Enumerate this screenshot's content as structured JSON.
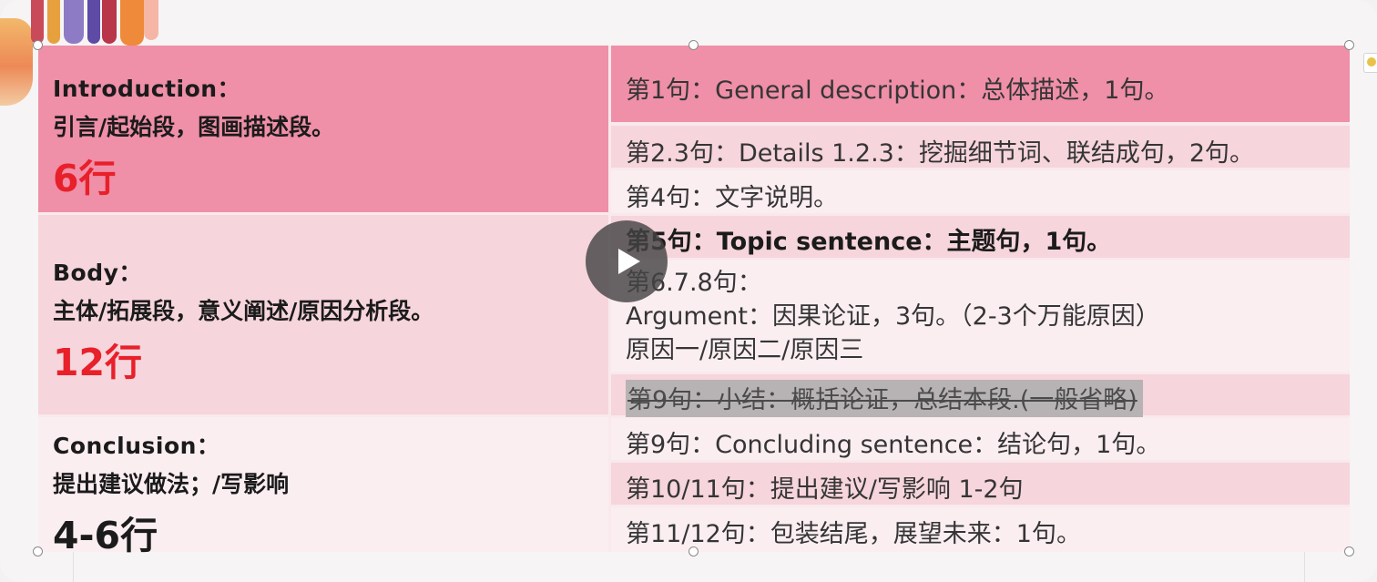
{
  "slide": {
    "sections": [
      {
        "title": "Introduction：",
        "description": "引言/起始段，图画描述段。",
        "lines": "6行",
        "lines_color": "#e8202a",
        "background": "#ef8fa8"
      },
      {
        "title": "Body：",
        "description": "主体/拓展段，意义阐述/原因分析段。",
        "lines": "12行",
        "lines_color": "#e8202a",
        "background": "#f6d5dc"
      },
      {
        "title": "Conclusion：",
        "description": "提出建议做法；/写影响",
        "lines": "4-6行",
        "lines_color": "#1b1b1b",
        "background": "#fbeef1"
      }
    ],
    "intro_rows": [
      "第1句：General description：总体描述，1句。",
      "第2.3句：Details 1.2.3：挖掘细节词、联结成句，2句。",
      "第4句：文字说明。"
    ],
    "body_rows": {
      "topic": "第5句：Topic sentence：主题句，1句。",
      "argument_line1": "第6.7.8句：",
      "argument_line2": "Argument：因果论证，3句。（2-3个万能原因）",
      "argument_line3": "原因一/原因二/原因三",
      "struck": "第9句：小结：概括论证，总结本段.(一般省略)"
    },
    "conclusion_rows": [
      "第9句：Concluding sentence：结论句，1句。",
      "第10/11句：提出建议/写影响 1-2句",
      "第11/12句：包装结尾，展望未来：1句。"
    ]
  },
  "colors": {
    "intro_header_pink": "#ef8fa8",
    "row_pink": "#f6d5dc",
    "row_light": "#fbeef1",
    "highlight_red": "#e8202a",
    "strike_gray": "#b7b3b5"
  },
  "icons": {
    "play": "play-icon",
    "edge": "comment-icon"
  }
}
